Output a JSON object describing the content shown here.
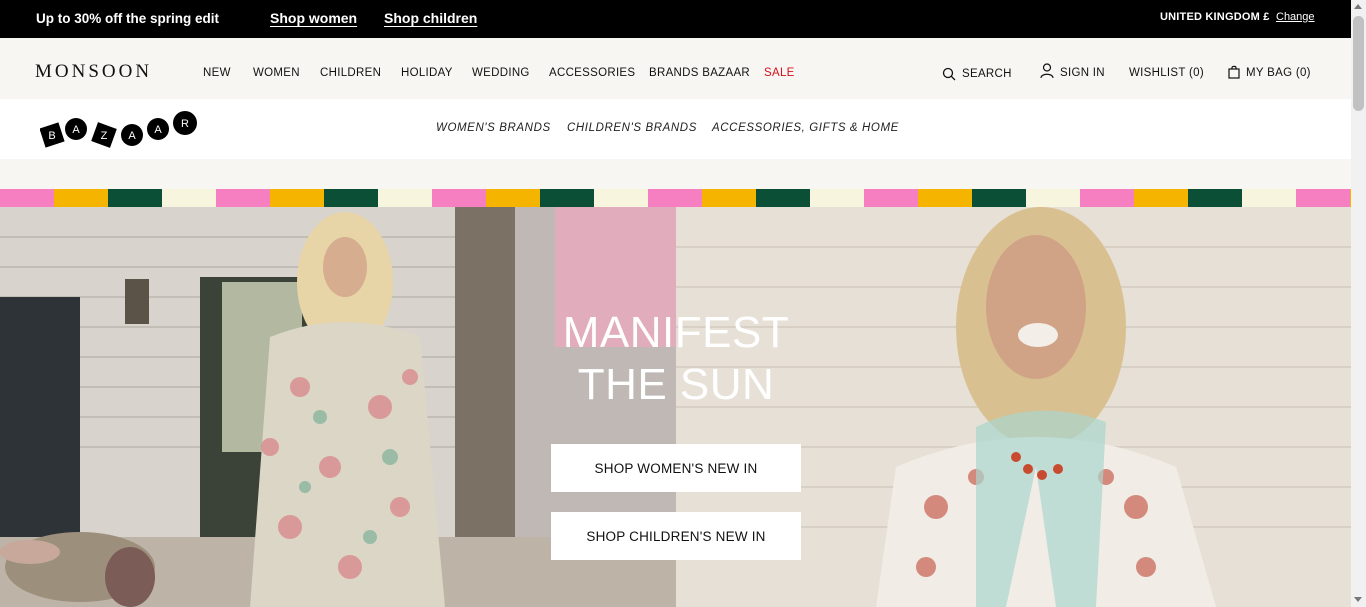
{
  "promo": {
    "message": "Up to 30% off the spring edit",
    "links": [
      "Shop women",
      "Shop children"
    ],
    "country": "UNITED KINGDOM £",
    "change": "Change"
  },
  "header": {
    "logo": "MONSOON",
    "nav": [
      "NEW",
      "WOMEN",
      "CHILDREN",
      "HOLIDAY",
      "WEDDING",
      "ACCESSORIES",
      "BRANDS BAZAAR",
      "SALE"
    ],
    "search": "SEARCH",
    "sign_in": "SIGN IN",
    "wishlist": "WISHLIST (0)",
    "bag": "MY BAG (0)"
  },
  "subnav": {
    "logo_letters": [
      "B",
      "A",
      "Z",
      "A",
      "A",
      "R"
    ],
    "items": [
      "WOMEN'S BRANDS",
      "CHILDREN'S BRANDS",
      "ACCESSORIES, GIFTS & HOME"
    ]
  },
  "stripe_colors": [
    "#f57fc0",
    "#f5b400",
    "#0b4f37",
    "#f8f5df"
  ],
  "hero": {
    "headline_line1": "MANIFEST",
    "headline_line2": "THE SUN",
    "cta_women": "SHOP WOMEN'S NEW IN",
    "cta_children": "SHOP CHILDREN'S NEW IN"
  },
  "colors": {
    "sale": "#d4111d",
    "promo_bg": "#000000",
    "nav_bg": "#f7f6f2"
  }
}
